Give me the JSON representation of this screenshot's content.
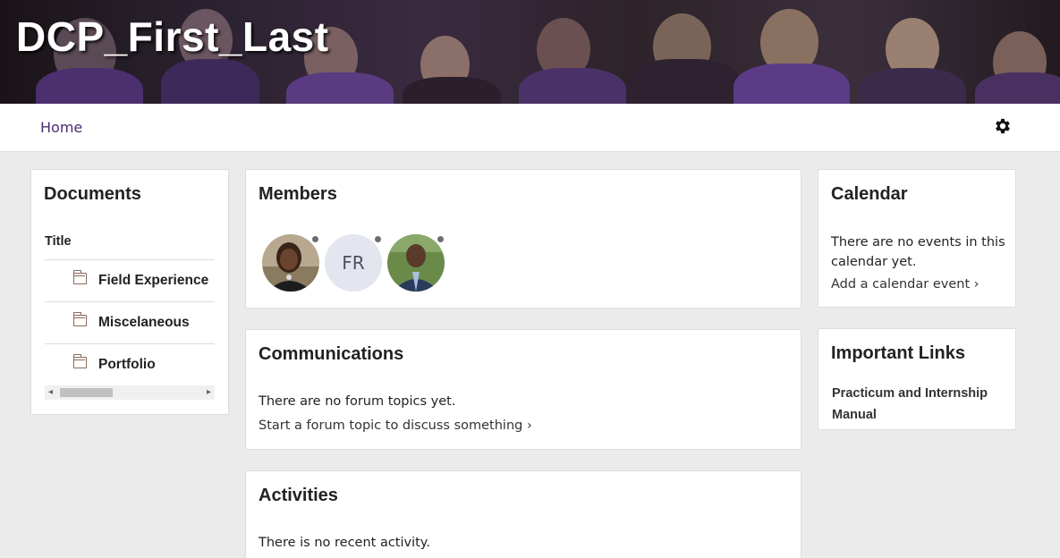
{
  "banner": {
    "title": "DCP_First_Last"
  },
  "nav": {
    "home_label": "Home",
    "settings_icon": "gear-icon"
  },
  "documents": {
    "title": "Documents",
    "column_header": "Title",
    "items": [
      {
        "label": "Field Experience",
        "icon": "folder-icon"
      },
      {
        "label": "Miscelaneous",
        "icon": "folder-icon"
      },
      {
        "label": "Portfolio",
        "icon": "folder-icon"
      }
    ],
    "scroll_left": "◂",
    "scroll_right": "▸"
  },
  "members": {
    "title": "Members",
    "avatars": [
      {
        "kind": "photo"
      },
      {
        "kind": "initials",
        "initials": "FR"
      },
      {
        "kind": "photo"
      }
    ]
  },
  "communications": {
    "title": "Communications",
    "empty_text": "There are no forum topics yet.",
    "action_link": "Start a forum topic to discuss something ›"
  },
  "activities": {
    "title": "Activities",
    "empty_text": "There is no recent activity."
  },
  "calendar": {
    "title": "Calendar",
    "empty_text": "There are no events in this calendar yet.",
    "action_link": "Add a calendar event ›"
  },
  "important_links": {
    "title": "Important Links",
    "items": [
      {
        "label": "Practicum and Internship Manual"
      }
    ]
  },
  "colors": {
    "nav_link": "#4b2a72",
    "background": "#ebebeb",
    "card": "#ffffff"
  }
}
